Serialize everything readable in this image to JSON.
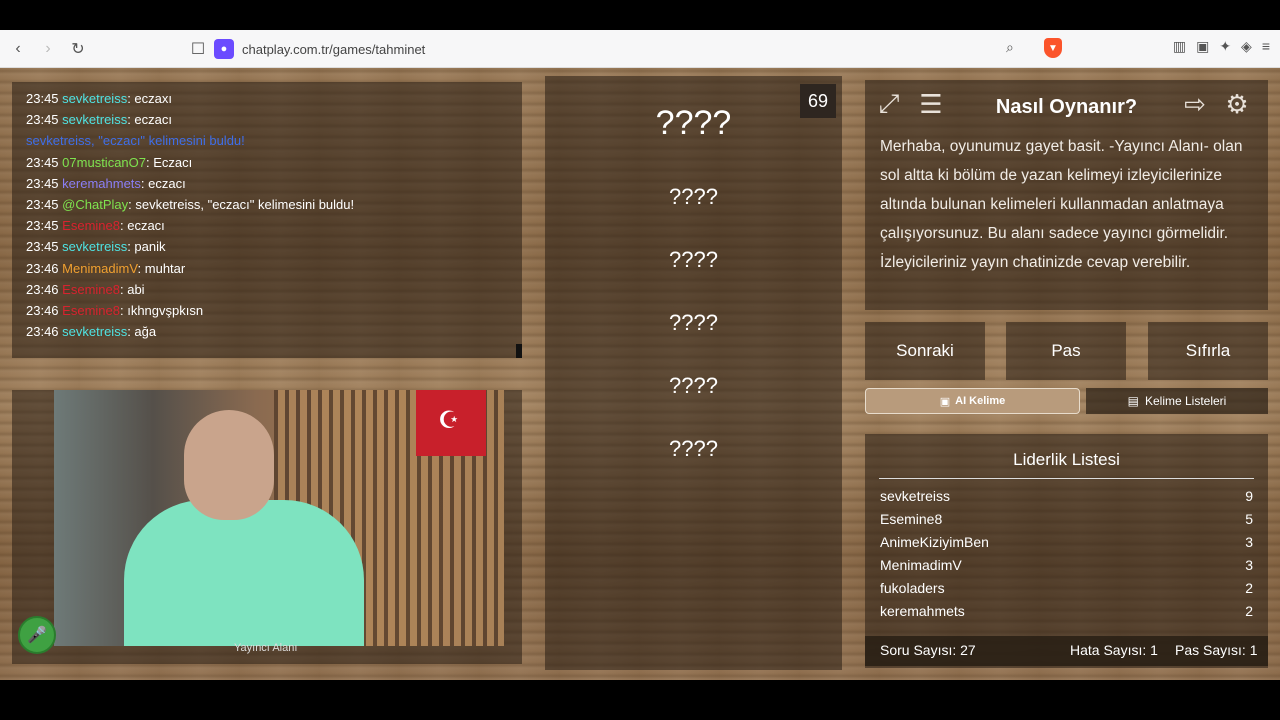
{
  "browser": {
    "url": "chatplay.com.tr/games/tahminet"
  },
  "chat": {
    "messages": [
      {
        "time": "23:45",
        "user": "sevketreiss",
        "user_color": "#4fe3e3",
        "text": ": eczaxı"
      },
      {
        "time": "23:45",
        "user": "sevketreiss",
        "user_color": "#4fe3e3",
        "text": ": eczacı"
      },
      {
        "time": "",
        "user": "sevketreiss, \"eczacı\" kelimesini buldu!",
        "user_color": "#3f6ee8",
        "text": ""
      },
      {
        "time": "23:45",
        "user": "07musticanO7",
        "user_color": "#7fe34f",
        "text": ": Eczacı"
      },
      {
        "time": "23:45",
        "user": "keremahmets",
        "user_color": "#8a7ef5",
        "text": ": eczacı"
      },
      {
        "time": "23:45",
        "user": "@ChatPlay",
        "user_color": "#7fe34f",
        "text": ": sevketreiss, \"eczacı\" kelimesini buldu!"
      },
      {
        "time": "23:45",
        "user": "Esemine8",
        "user_color": "#d8232f",
        "text": ": eczacı"
      },
      {
        "time": "23:45",
        "user": "sevketreiss",
        "user_color": "#4fe3e3",
        "text": ": panik"
      },
      {
        "time": "23:46",
        "user": "MenimadimV",
        "user_color": "#f0a030",
        "text": ": muhtar"
      },
      {
        "time": "23:46",
        "user": "Esemine8",
        "user_color": "#d8232f",
        "text": ": abi"
      },
      {
        "time": "23:46",
        "user": "Esemine8",
        "user_color": "#d8232f",
        "text": ": ıkhngvşpkısn"
      },
      {
        "time": "23:46",
        "user": "sevketreiss",
        "user_color": "#4fe3e3",
        "text": ": ağa"
      }
    ]
  },
  "video": {
    "label": "Yayıncı Alanı"
  },
  "words": {
    "timer": "69",
    "main": "????",
    "hidden": [
      "????",
      "????",
      "????",
      "????",
      "????"
    ]
  },
  "howto": {
    "title": "Nasıl Oynanır?",
    "text": "Merhaba, oyunumuz gayet basit. -Yayıncı Alanı- olan sol altta ki bölüm de yazan kelimeyi izleyicilerinize altında bulunan kelimeleri kullanmadan anlatmaya çalışıyorsunuz. Bu alanı sadece yayıncı görmelidir. İzleyicileriniz yayın chatinizde cevap verebilir."
  },
  "actions": {
    "next": "Sonraki",
    "pass": "Pas",
    "reset": "Sıfırla",
    "ai_word": "AI Kelime",
    "word_lists": "Kelime Listeleri"
  },
  "leaderboard": {
    "title": "Liderlik Listesi",
    "rows": [
      {
        "name": "sevketreiss",
        "score": "9"
      },
      {
        "name": "Esemine8",
        "score": "5"
      },
      {
        "name": "AnimeKiziyimBen",
        "score": "3"
      },
      {
        "name": "MenimadimV",
        "score": "3"
      },
      {
        "name": "fukoladers",
        "score": "2"
      },
      {
        "name": "keremahmets",
        "score": "2"
      }
    ]
  },
  "stats": {
    "questions": "Soru Sayısı: 27",
    "errors": "Hata Sayısı: 1",
    "passes": "Pas Sayısı: 1"
  }
}
